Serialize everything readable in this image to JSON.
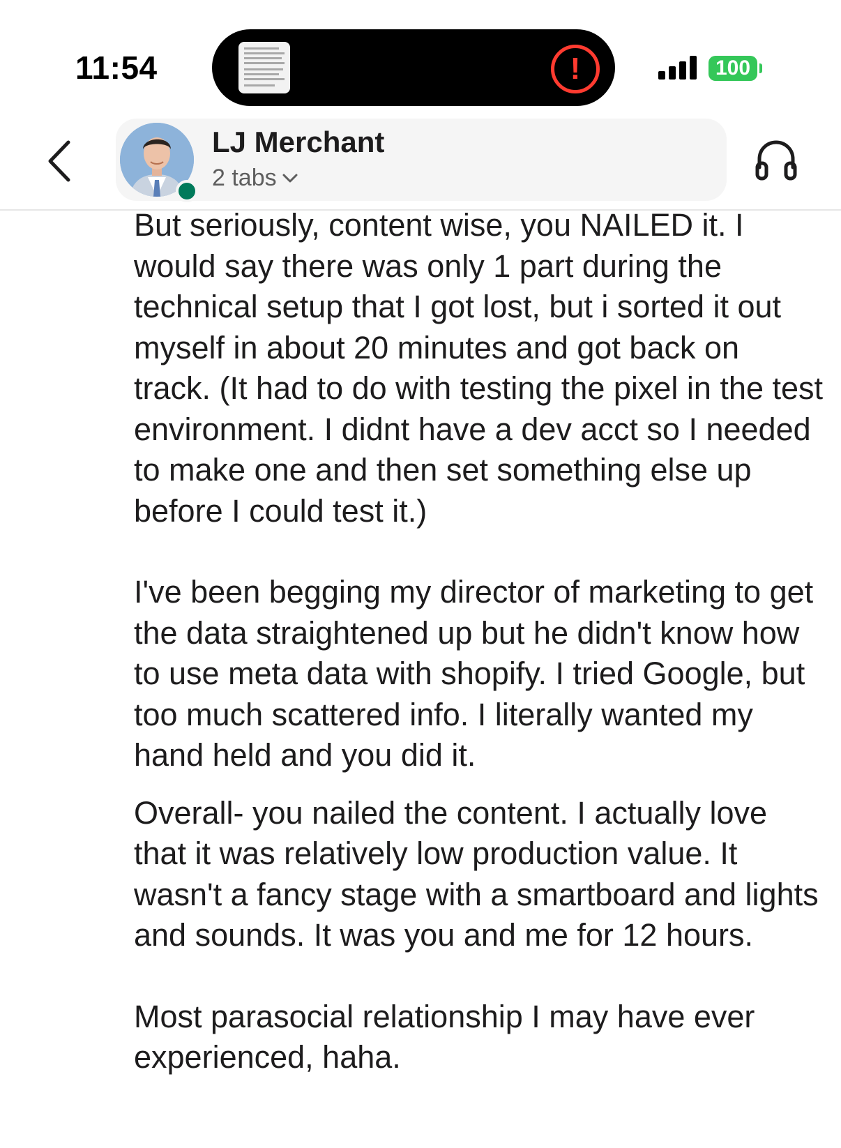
{
  "status_bar": {
    "time": "11:54",
    "battery": "100"
  },
  "header": {
    "back_icon": "chevron-left-icon",
    "contact_name": "LJ Merchant",
    "tabs_label": "2 tabs",
    "presence": "online",
    "presence_color": "#007a5a",
    "call_icon": "headphones-icon"
  },
  "message": {
    "paragraphs": [
      "But seriously, content wise, you NAILED it. I would say there was only 1 part during the technical setup that I got lost, but i sorted it out myself in about 20 minutes and got back on track. (It had to do with testing the pixel in the test environment. I didnt have a dev acct so I needed to make one and then set something else up before I could test it.)",
      "I've been begging my director of marketing to get the data straightened up but he didn't know how to use meta data with shopify. I tried Google, but too much scattered info. I literally wanted my hand held and you did it.",
      "Overall- you nailed the content. I actually love that it was relatively low production value. It wasn't a fancy stage with a smartboard and lights and sounds. It was you and me for 12 hours.",
      "Most parasocial relationship I may have ever experienced, haha."
    ]
  },
  "colors": {
    "battery": "#34c759",
    "alert": "#ff3b30",
    "text": "#1d1c1d"
  }
}
